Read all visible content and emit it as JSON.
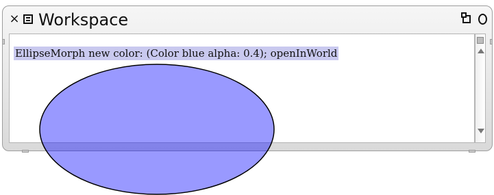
{
  "window": {
    "title": "Workspace",
    "buttons": {
      "close_icon": "close-icon",
      "menu_icon": "menu-icon",
      "collapse_icon": "collapse-icon",
      "expand_icon": "expand-icon"
    }
  },
  "editor": {
    "code": "EllipseMorph new color: (Color blue alpha: 0.4); openInWorld",
    "selection_color": "#c9c9ef"
  },
  "morph": {
    "fill_color": "#0000ff",
    "alpha": 0.4,
    "stroke_color": "#000000"
  }
}
